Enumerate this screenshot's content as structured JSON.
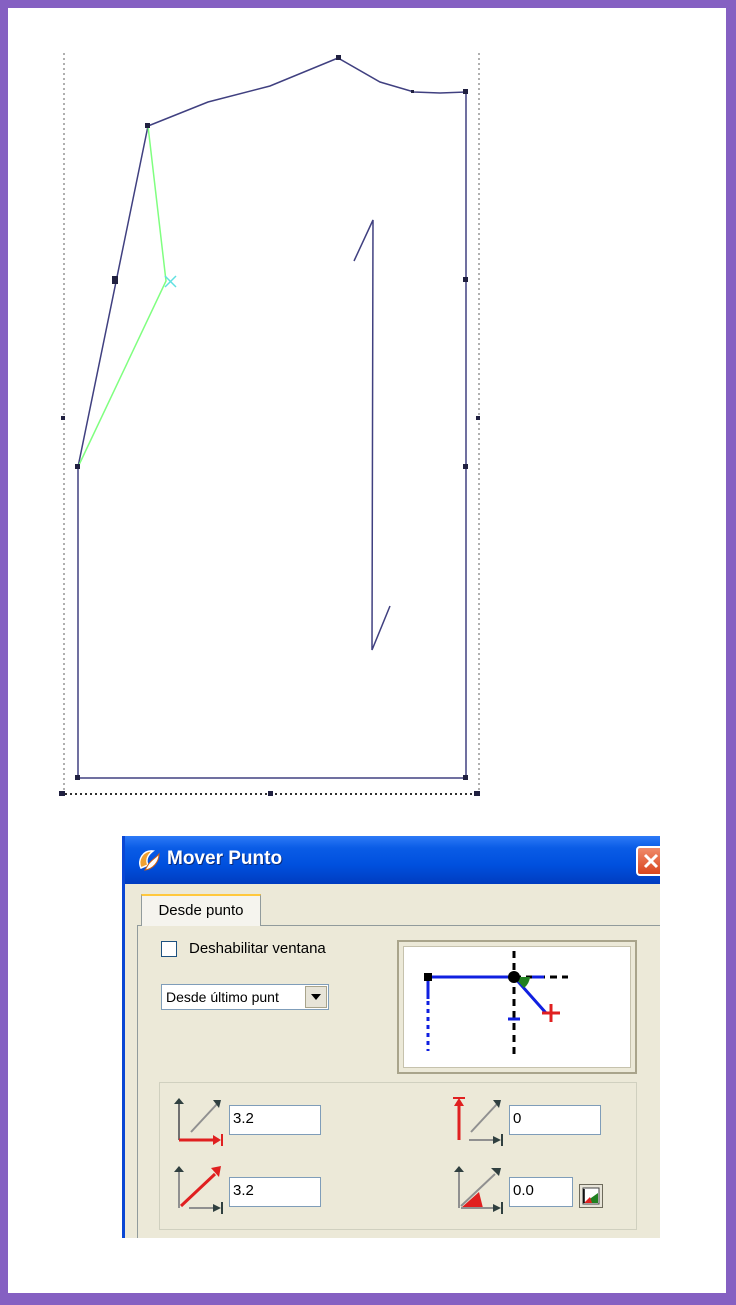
{
  "colors": {
    "frame_border": "#8560c2",
    "pattern_line": "#404080",
    "highlight_line": "#80ff80",
    "dialog_title": "#0050de",
    "panel_bg": "#ece9d8"
  },
  "dialog": {
    "title": "Mover Punto",
    "title_icon": "app-icon",
    "close_icon": "close-icon",
    "tab_label": "Desde punto",
    "disable_checkbox": {
      "label": "Deshabilitar ventana",
      "checked": false
    },
    "reference_select": {
      "value": "Desde último punt"
    },
    "fields": {
      "horizontal_offset": "3.2",
      "vertical_offset": "0",
      "distance": "3.2",
      "angle": "0.0"
    },
    "icons": {
      "horizontal": "horizontal-offset-icon",
      "vertical": "vertical-offset-icon",
      "distance": "distance-icon",
      "angle": "angle-icon",
      "angle_button": "angle-picker-icon",
      "preview": "move-preview-diagram"
    }
  }
}
